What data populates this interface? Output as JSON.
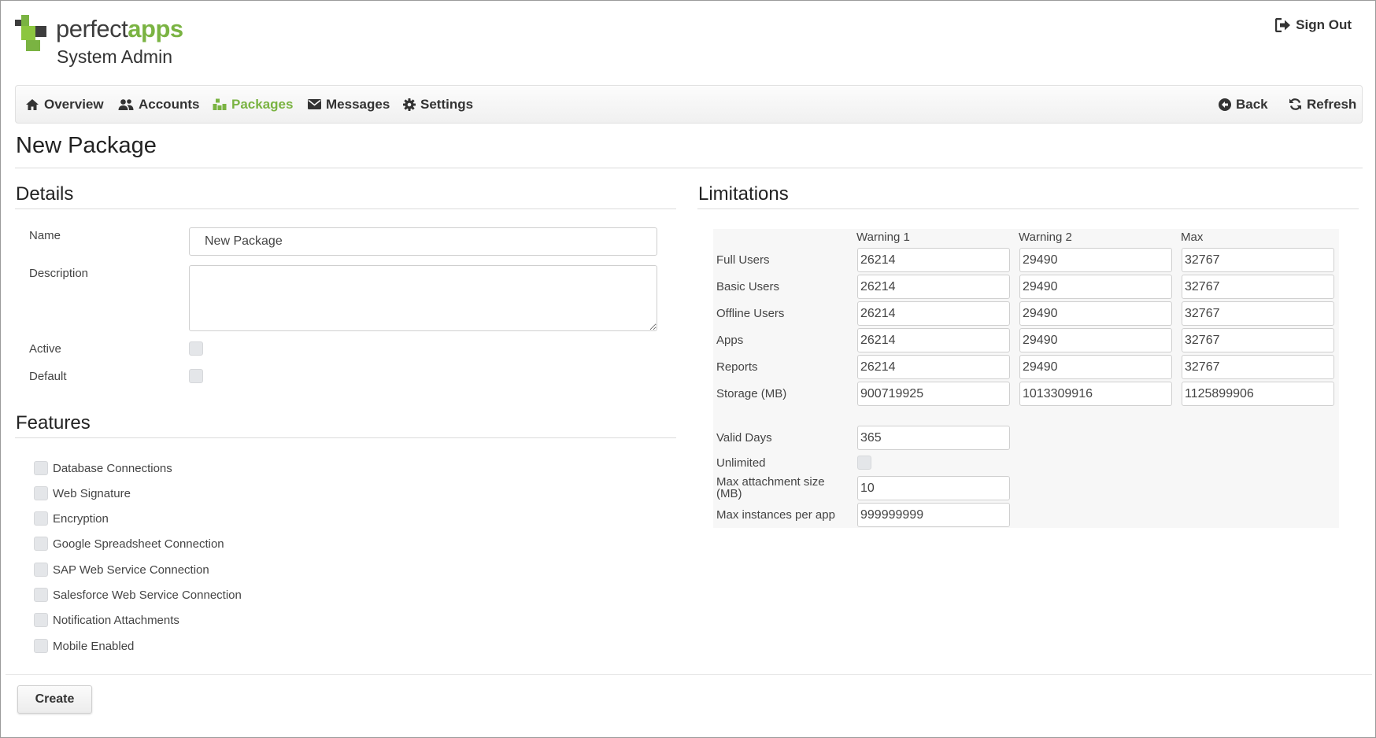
{
  "brand": {
    "name_part1": "perfect",
    "name_part2": "apps",
    "subtitle": "System Admin"
  },
  "header": {
    "signout_label": "Sign Out"
  },
  "nav": {
    "items": [
      {
        "label": "Overview",
        "icon": "home-icon"
      },
      {
        "label": "Accounts",
        "icon": "users-icon"
      },
      {
        "label": "Packages",
        "icon": "packages-icon",
        "active": true
      },
      {
        "label": "Messages",
        "icon": "envelope-icon"
      },
      {
        "label": "Settings",
        "icon": "gear-icon"
      }
    ],
    "back_label": "Back",
    "refresh_label": "Refresh"
  },
  "page": {
    "title": "New Package"
  },
  "details": {
    "title": "Details",
    "name_label": "Name",
    "name_value": "New Package",
    "description_label": "Description",
    "description_value": "",
    "active_label": "Active",
    "default_label": "Default"
  },
  "features": {
    "title": "Features",
    "items": [
      "Database Connections",
      "Web Signature",
      "Encryption",
      "Google Spreadsheet Connection",
      "SAP Web Service Connection",
      "Salesforce Web Service Connection",
      "Notification Attachments",
      "Mobile Enabled"
    ]
  },
  "limitations": {
    "title": "Limitations",
    "columns": [
      "Warning 1",
      "Warning 2",
      "Max"
    ],
    "rows": [
      {
        "label": "Full Users",
        "values": [
          "26214",
          "29490",
          "32767"
        ]
      },
      {
        "label": "Basic Users",
        "values": [
          "26214",
          "29490",
          "32767"
        ]
      },
      {
        "label": "Offline Users",
        "values": [
          "26214",
          "29490",
          "32767"
        ]
      },
      {
        "label": "Apps",
        "values": [
          "26214",
          "29490",
          "32767"
        ]
      },
      {
        "label": "Reports",
        "values": [
          "26214",
          "29490",
          "32767"
        ]
      },
      {
        "label": "Storage (MB)",
        "values": [
          "900719925",
          "1013309916",
          "1125899906"
        ]
      }
    ],
    "valid_days_label": "Valid Days",
    "valid_days_value": "365",
    "unlimited_label": "Unlimited",
    "max_attachment_label": "Max attachment size (MB)",
    "max_attachment_value": "10",
    "max_instances_label": "Max instances per app",
    "max_instances_value": "999999999"
  },
  "actions": {
    "create_label": "Create"
  },
  "colors": {
    "brand_green": "#7ab342",
    "brand_dark": "#3d3d3d"
  }
}
